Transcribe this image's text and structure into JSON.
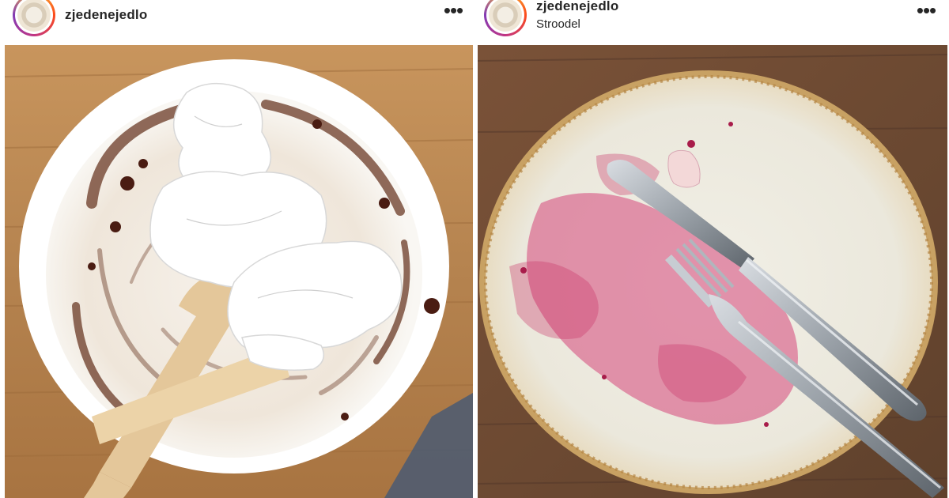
{
  "posts": [
    {
      "username": "zjedenejedlo",
      "location": "",
      "more_icon": "ellipsis-horizontal-icon",
      "photo_icon": "paper-plate-photo"
    },
    {
      "username": "zjedenejedlo",
      "location": "Stroodel",
      "more_icon": "ellipsis-horizontal-icon",
      "photo_icon": "ceramic-plate-photo"
    }
  ],
  "colors": {
    "text": "#262626",
    "wood_left": "#b5834f",
    "wood_right": "#6b4a33",
    "stain_left": "#5a2a1c",
    "stain_right": "#d14c7a"
  }
}
